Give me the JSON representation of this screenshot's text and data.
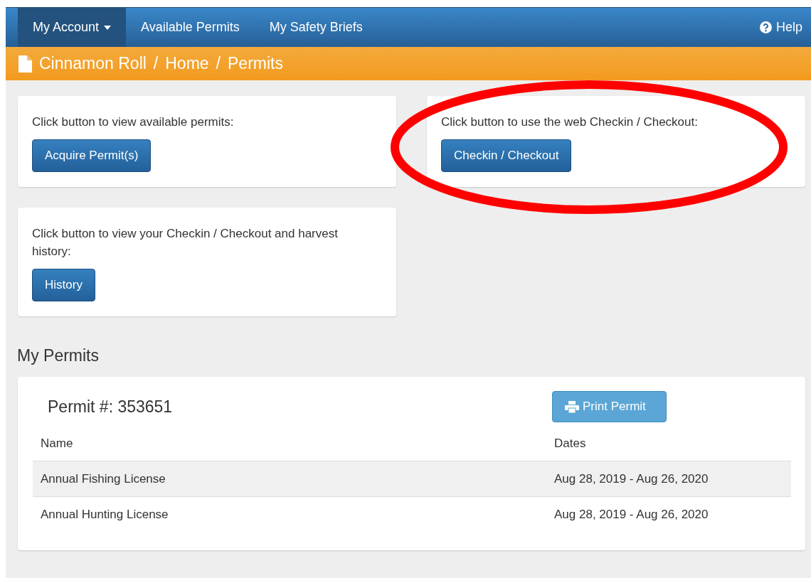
{
  "navbar": {
    "items": [
      {
        "label": "My Account",
        "dropdown": true,
        "selected": true
      },
      {
        "label": "Available Permits",
        "dropdown": false,
        "selected": false
      },
      {
        "label": "My Safety Briefs",
        "dropdown": false,
        "selected": false
      }
    ],
    "help": "Help"
  },
  "breadcrumb": [
    "Cinnamon Roll",
    "Home",
    "Permits"
  ],
  "breadcrumb_separator": "/",
  "cards": [
    {
      "text": "Click button to view available permits:",
      "button": "Acquire Permit(s)",
      "highlighted": false
    },
    {
      "text": "Click button to use the web Checkin / Checkout:",
      "button": "Checkin / Checkout",
      "highlighted": true
    },
    {
      "text": "Click button to view your Checkin / Checkout and harvest history:",
      "button": "History",
      "highlighted": false
    }
  ],
  "permits_section": {
    "title": "My Permits",
    "permit_number": "Permit #: 353651",
    "print_button": "Print Permit",
    "columns": [
      "Name",
      "Dates"
    ],
    "rows": [
      {
        "name": "Annual Fishing License",
        "dates": "Aug 28, 2019 - Aug 26, 2020",
        "striped": true
      },
      {
        "name": "Annual Hunting License",
        "dates": "Aug 28, 2019 - Aug 26, 2020",
        "striped": false
      }
    ]
  }
}
